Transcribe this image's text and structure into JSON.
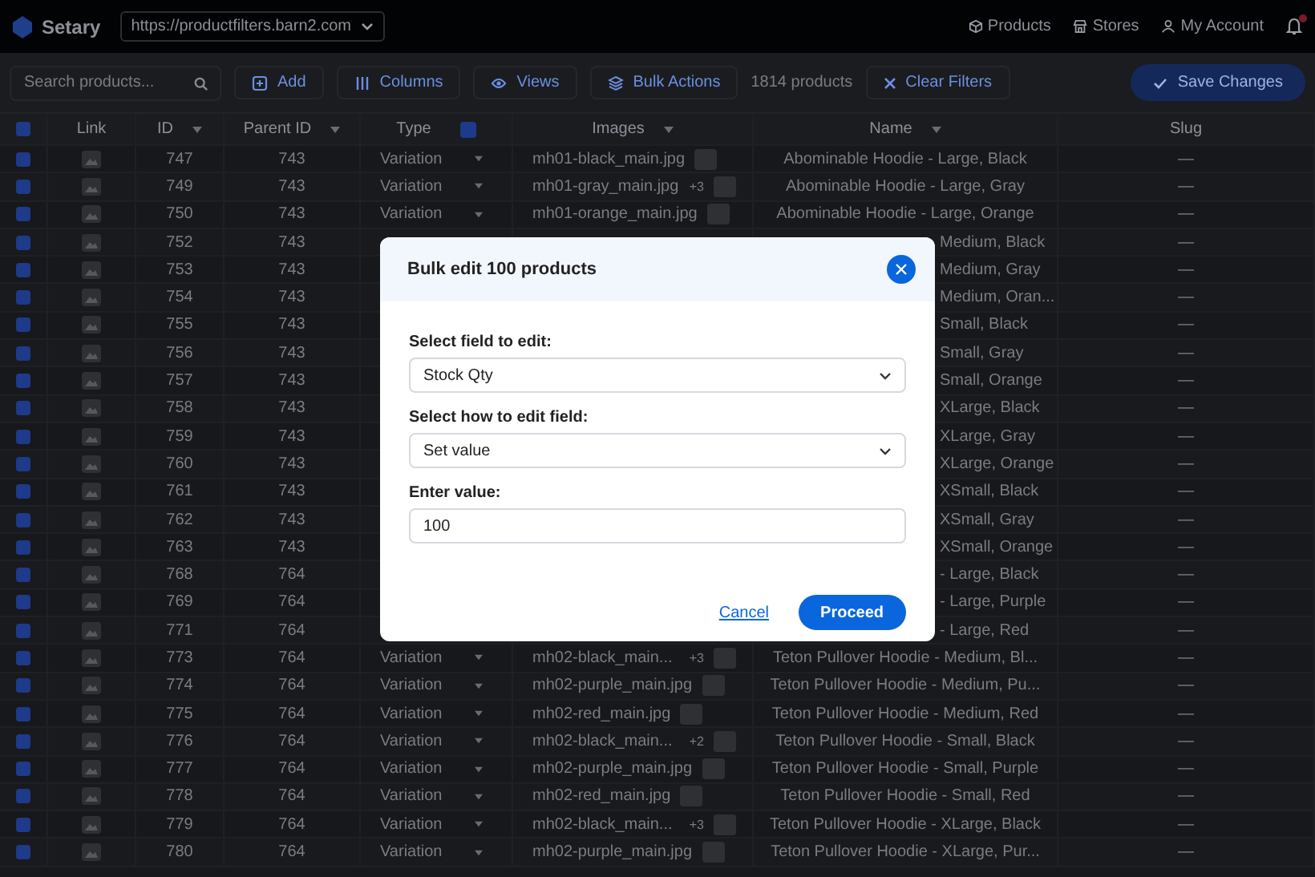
{
  "topbar": {
    "brand": "Setary",
    "site": "https://productfilters.barn2.com",
    "nav": [
      "Products",
      "Stores",
      "My Account"
    ]
  },
  "toolbar": {
    "search": {
      "placeholder": "Search products..."
    },
    "actions": [
      "Add",
      "Columns",
      "Views",
      "Bulk Actions"
    ],
    "count": "1814 products",
    "clear": "Clear Filters",
    "save": "Save Changes"
  },
  "table": {
    "all_checked": true,
    "columns": [
      "Link",
      "ID",
      "Parent ID",
      "Type",
      "Images",
      "Name",
      "Slug"
    ],
    "rows": [
      {
        "kind": "full",
        "checked": true,
        "id": "747",
        "parent_id": "743",
        "type": "Variation",
        "image": "mh01-black_main.jpg",
        "name": "Abominable Hoodie - Large, Black",
        "slug": "—"
      },
      {
        "kind": "full",
        "checked": true,
        "id": "749",
        "parent_id": "743",
        "type": "Variation",
        "image": "mh01-gray_main.jpg",
        "extra": "+3",
        "name": "Abominable Hoodie - Large, Gray",
        "slug": "—"
      },
      {
        "kind": "full",
        "checked": true,
        "id": "750",
        "parent_id": "743",
        "type": "Variation",
        "image": "mh01-orange_main.jpg",
        "name": "Abominable Hoodie - Large, Orange",
        "slug": "—"
      },
      {
        "kind": "covered",
        "checked": true,
        "id": "752",
        "parent_id": "743",
        "name": "Medium, Black",
        "slug": "—"
      },
      {
        "kind": "covered",
        "checked": true,
        "id": "753",
        "parent_id": "743",
        "name": "Medium, Gray",
        "slug": "—"
      },
      {
        "kind": "covered",
        "checked": true,
        "id": "754",
        "parent_id": "743",
        "name": "Medium, Oran...",
        "slug": "—"
      },
      {
        "kind": "covered",
        "checked": true,
        "id": "755",
        "parent_id": "743",
        "name": "Small, Black",
        "slug": "—"
      },
      {
        "kind": "covered",
        "checked": true,
        "id": "756",
        "parent_id": "743",
        "name": "Small, Gray",
        "slug": "—"
      },
      {
        "kind": "covered",
        "checked": true,
        "id": "757",
        "parent_id": "743",
        "name": "Small, Orange",
        "slug": "—"
      },
      {
        "kind": "covered",
        "checked": true,
        "id": "758",
        "parent_id": "743",
        "name": "XLarge, Black",
        "slug": "—"
      },
      {
        "kind": "covered",
        "checked": true,
        "id": "759",
        "parent_id": "743",
        "name": "XLarge, Gray",
        "slug": "—"
      },
      {
        "kind": "covered",
        "checked": true,
        "id": "760",
        "parent_id": "743",
        "name": "XLarge, Orange",
        "slug": "—"
      },
      {
        "kind": "covered",
        "checked": true,
        "id": "761",
        "parent_id": "743",
        "name": "XSmall, Black",
        "slug": "—"
      },
      {
        "kind": "covered",
        "checked": true,
        "id": "762",
        "parent_id": "743",
        "name": "XSmall, Gray",
        "slug": "—"
      },
      {
        "kind": "covered",
        "checked": true,
        "id": "763",
        "parent_id": "743",
        "name": "XSmall, Orange",
        "slug": "—"
      },
      {
        "kind": "covered",
        "checked": true,
        "id": "768",
        "parent_id": "764",
        "name": "- Large, Black",
        "slug": "—"
      },
      {
        "kind": "covered",
        "checked": true,
        "id": "769",
        "parent_id": "764",
        "name": "- Large, Purple",
        "slug": "—"
      },
      {
        "kind": "covered",
        "checked": true,
        "id": "771",
        "parent_id": "764",
        "name": "- Large, Red",
        "slug": "—"
      },
      {
        "kind": "full",
        "checked": true,
        "id": "773",
        "parent_id": "764",
        "type": "Variation",
        "image": "mh02-black_main...",
        "extra": "+3",
        "name": "Teton Pullover Hoodie - Medium, Bl...",
        "slug": "—"
      },
      {
        "kind": "full",
        "checked": true,
        "id": "774",
        "parent_id": "764",
        "type": "Variation",
        "image": "mh02-purple_main.jpg",
        "name": "Teton Pullover Hoodie - Medium, Pu...",
        "slug": "—"
      },
      {
        "kind": "full",
        "checked": true,
        "id": "775",
        "parent_id": "764",
        "type": "Variation",
        "image": "mh02-red_main.jpg",
        "name": "Teton Pullover Hoodie - Medium, Red",
        "slug": "—"
      },
      {
        "kind": "full",
        "checked": true,
        "id": "776",
        "parent_id": "764",
        "type": "Variation",
        "image": "mh02-black_main...",
        "extra": "+2",
        "name": "Teton Pullover Hoodie - Small, Black",
        "slug": "—"
      },
      {
        "kind": "full",
        "checked": true,
        "id": "777",
        "parent_id": "764",
        "type": "Variation",
        "image": "mh02-purple_main.jpg",
        "name": "Teton Pullover Hoodie - Small, Purple",
        "slug": "—"
      },
      {
        "kind": "full",
        "checked": true,
        "id": "778",
        "parent_id": "764",
        "type": "Variation",
        "image": "mh02-red_main.jpg",
        "name": "Teton Pullover Hoodie - Small, Red",
        "slug": "—"
      },
      {
        "kind": "full",
        "checked": true,
        "id": "779",
        "parent_id": "764",
        "type": "Variation",
        "image": "mh02-black_main...",
        "extra": "+3",
        "name": "Teton Pullover Hoodie - XLarge, Black",
        "slug": "—"
      },
      {
        "kind": "full",
        "checked": true,
        "id": "780",
        "parent_id": "764",
        "type": "Variation",
        "image": "mh02-purple_main.jpg",
        "name": "Teton Pullover Hoodie - XLarge, Pur...",
        "slug": "—"
      }
    ]
  },
  "dialog": {
    "title": "Bulk edit 100 products",
    "fields": [
      {
        "kind": "select",
        "label": "Select field to edit:",
        "value": "Stock Qty"
      },
      {
        "kind": "select",
        "label": "Select how to edit field:",
        "value": "Set value"
      },
      {
        "kind": "input",
        "label": "Enter value:",
        "value": "100"
      }
    ],
    "cancel": "Cancel",
    "proceed": "Proceed"
  }
}
